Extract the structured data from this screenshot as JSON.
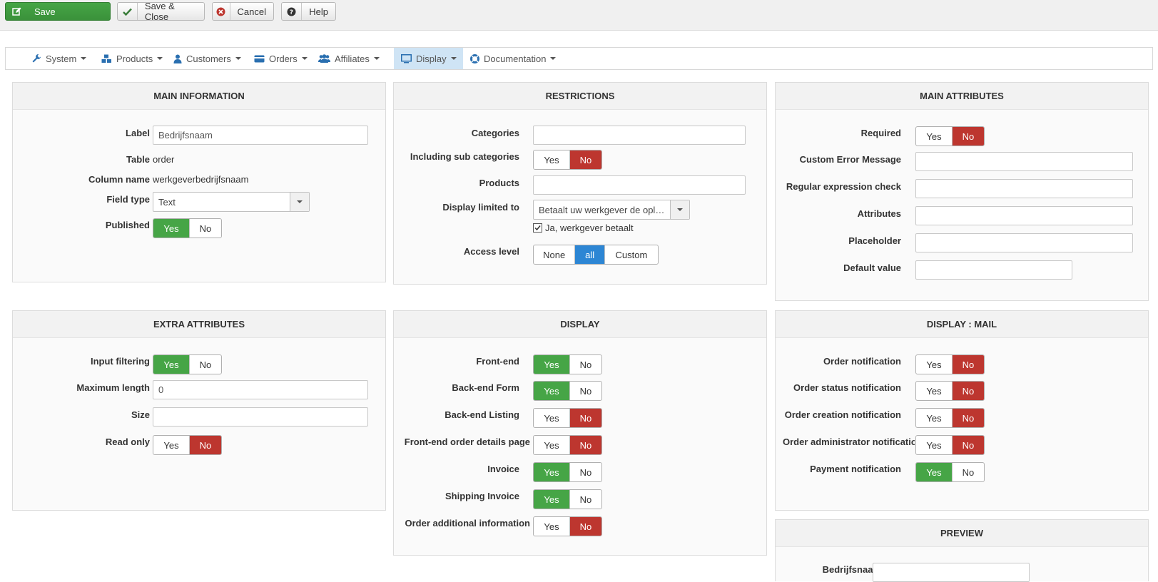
{
  "toolbar": {
    "save": "Save",
    "save_close": "Save & Close",
    "cancel": "Cancel",
    "help": "Help"
  },
  "menu": [
    {
      "label": "System",
      "icon": "wrench-icon"
    },
    {
      "label": "Products",
      "icon": "cubes-icon"
    },
    {
      "label": "Customers",
      "icon": "user-icon"
    },
    {
      "label": "Orders",
      "icon": "credit-card-icon"
    },
    {
      "label": "Affiliates",
      "icon": "users-icon"
    },
    {
      "label": "Display",
      "icon": "monitor-icon"
    },
    {
      "label": "Documentation",
      "icon": "lifebuoy-icon"
    }
  ],
  "main_info": {
    "title": "MAIN INFORMATION",
    "label_lbl": "Label",
    "label_val": "Bedrijfsnaam",
    "table_lbl": "Table",
    "table_val": "order",
    "column_lbl": "Column name",
    "column_val": "werkgeverbedrijfsnaam",
    "fieldtype_lbl": "Field type",
    "fieldtype_val": "Text",
    "published_lbl": "Published"
  },
  "restrictions": {
    "title": "RESTRICTIONS",
    "categories_lbl": "Categories",
    "subcats_lbl": "Including sub categories",
    "products_lbl": "Products",
    "display_limited_lbl": "Display limited to",
    "display_limited_val": "Betaalt uw werkgever de opleiding?",
    "check_label": "Ja, werkgever betaalt",
    "access_lbl": "Access level",
    "access_none": "None",
    "access_all": "all",
    "access_custom": "Custom"
  },
  "main_attributes": {
    "title": "MAIN ATTRIBUTES",
    "required_lbl": "Required",
    "error_msg_lbl": "Custom Error Message",
    "regex_lbl": "Regular expression check",
    "attributes_lbl": "Attributes",
    "placeholder_lbl": "Placeholder",
    "default_lbl": "Default value"
  },
  "extra_attributes": {
    "title": "EXTRA ATTRIBUTES",
    "input_filter_lbl": "Input filtering",
    "max_len_lbl": "Maximum length",
    "max_len_val": "0",
    "size_lbl": "Size",
    "readonly_lbl": "Read only"
  },
  "display": {
    "title": "DISPLAY",
    "frontend_lbl": "Front-end",
    "backend_form_lbl": "Back-end Form",
    "backend_listing_lbl": "Back-end Listing",
    "frontend_order_lbl": "Front-end order details page",
    "invoice_lbl": "Invoice",
    "shipping_invoice_lbl": "Shipping Invoice",
    "order_additional_lbl": "Order additional information"
  },
  "display_mail": {
    "title": "DISPLAY : MAIL",
    "order_notif_lbl": "Order notification",
    "status_notif_lbl": "Order status notification",
    "creation_notif_lbl": "Order creation notification",
    "admin_notif_lbl": "Order administrator notification",
    "payment_notif_lbl": "Payment notification"
  },
  "preview": {
    "title": "PREVIEW",
    "field_lbl": "Bedrijfsnaam"
  },
  "common": {
    "yes": "Yes",
    "no": "No"
  },
  "colors": {
    "green": "#46a546",
    "red": "#bd362f",
    "blue": "#2d86d4"
  }
}
